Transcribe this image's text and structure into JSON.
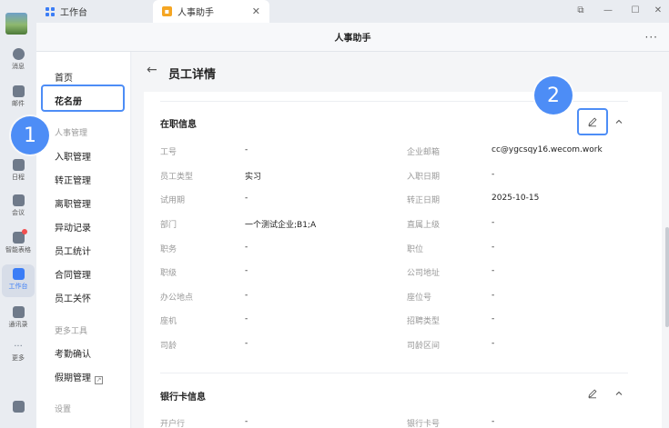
{
  "tabs": [
    {
      "label": "工作台",
      "icon": "grid-icon"
    },
    {
      "label": "人事助手",
      "icon": "user-card-icon",
      "active": true
    }
  ],
  "rail": [
    {
      "label": "消息",
      "icon": "chat-icon"
    },
    {
      "label": "邮件",
      "icon": "mail-icon"
    },
    {
      "label": "日程",
      "icon": "calendar-icon"
    },
    {
      "label": "会议",
      "icon": "meeting-icon"
    },
    {
      "label": "智能表格",
      "icon": "sheet-icon"
    },
    {
      "label": "工作台",
      "icon": "apps-icon",
      "active": true
    },
    {
      "label": "通讯录",
      "icon": "contacts-icon"
    },
    {
      "label": "更多",
      "icon": "more-icon"
    }
  ],
  "appbar": {
    "title": "人事助手",
    "more": "···"
  },
  "subnav": {
    "home": "首页",
    "roster": "花名册",
    "hr_section": "人事管理",
    "items": [
      "入职管理",
      "转正管理",
      "离职管理",
      "异动记录",
      "员工统计",
      "合同管理",
      "员工关怀"
    ],
    "tools_section": "更多工具",
    "tools": [
      "考勤确认",
      "假期管理"
    ],
    "settings_section": "设置"
  },
  "page": {
    "title": "员工详情",
    "back": "←"
  },
  "job_info": {
    "title": "在职信息",
    "rows": [
      {
        "l_label": "工号",
        "l_value": "-",
        "r_label": "企业邮箱",
        "r_value": "cc@ygcsqy16.wecom.work"
      },
      {
        "l_label": "员工类型",
        "l_value": "实习",
        "r_label": "入职日期",
        "r_value": "-"
      },
      {
        "l_label": "试用期",
        "l_value": "-",
        "r_label": "转正日期",
        "r_value": "2025-10-15"
      },
      {
        "l_label": "部门",
        "l_value": "一个测试企业;B1;A",
        "r_label": "直属上级",
        "r_value": "-"
      },
      {
        "l_label": "职务",
        "l_value": "-",
        "r_label": "职位",
        "r_value": "-"
      },
      {
        "l_label": "职级",
        "l_value": "-",
        "r_label": "公司地址",
        "r_value": "-"
      },
      {
        "l_label": "办公地点",
        "l_value": "-",
        "r_label": "座位号",
        "r_value": "-"
      },
      {
        "l_label": "座机",
        "l_value": "-",
        "r_label": "招聘类型",
        "r_value": "-"
      },
      {
        "l_label": "司龄",
        "l_value": "-",
        "r_label": "司龄区间",
        "r_value": "-"
      }
    ]
  },
  "bank_info": {
    "title": "银行卡信息",
    "rows": [
      {
        "l_label": "开户行",
        "l_value": "-",
        "r_label": "银行卡号",
        "r_value": "-"
      }
    ]
  },
  "callouts": [
    "1",
    "2"
  ],
  "colors": {
    "accent": "#4d8df6",
    "brand": "#3b7df6"
  }
}
